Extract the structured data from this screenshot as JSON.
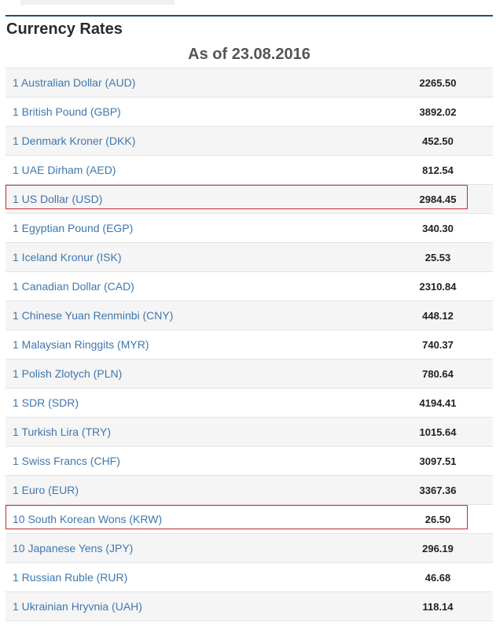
{
  "page": {
    "title": "Currency Rates",
    "as_of": "As of 23.08.2016"
  },
  "rates": [
    {
      "name": "1 Australian Dollar (AUD)",
      "value": "2265.50",
      "highlighted": false
    },
    {
      "name": "1 British Pound (GBP)",
      "value": "3892.02",
      "highlighted": false
    },
    {
      "name": "1 Denmark Kroner (DKK)",
      "value": "452.50",
      "highlighted": false
    },
    {
      "name": "1 UAE Dirham (AED)",
      "value": "812.54",
      "highlighted": false
    },
    {
      "name": "1 US Dollar (USD)",
      "value": "2984.45",
      "highlighted": true
    },
    {
      "name": "1 Egyptian Pound (EGP)",
      "value": "340.30",
      "highlighted": false
    },
    {
      "name": "1 Iceland Kronur (ISK)",
      "value": "25.53",
      "highlighted": false
    },
    {
      "name": "1 Canadian Dollar (CAD)",
      "value": "2310.84",
      "highlighted": false
    },
    {
      "name": "1 Chinese Yuan Renminbi (CNY)",
      "value": "448.12",
      "highlighted": false
    },
    {
      "name": "1 Malaysian Ringgits (MYR)",
      "value": "740.37",
      "highlighted": false
    },
    {
      "name": "1 Polish Zlotych (PLN)",
      "value": "780.64",
      "highlighted": false
    },
    {
      "name": "1 SDR (SDR)",
      "value": "4194.41",
      "highlighted": false
    },
    {
      "name": "1 Turkish Lira (TRY)",
      "value": "1015.64",
      "highlighted": false
    },
    {
      "name": "1 Swiss Francs (CHF)",
      "value": "3097.51",
      "highlighted": false
    },
    {
      "name": "1 Euro (EUR)",
      "value": "3367.36",
      "highlighted": false
    },
    {
      "name": "10 South Korean Wons (KRW)",
      "value": "26.50",
      "highlighted": true
    },
    {
      "name": "10 Japanese Yens (JPY)",
      "value": "296.19",
      "highlighted": false
    },
    {
      "name": "1 Russian Ruble (RUR)",
      "value": "46.68",
      "highlighted": false
    },
    {
      "name": "1 Ukrainian Hryvnia (UAH)",
      "value": "118.14",
      "highlighted": false
    }
  ],
  "colors": {
    "link": "#3f77ad",
    "highlight_border": "#c62a2a",
    "header_rule": "#1f4e78"
  }
}
